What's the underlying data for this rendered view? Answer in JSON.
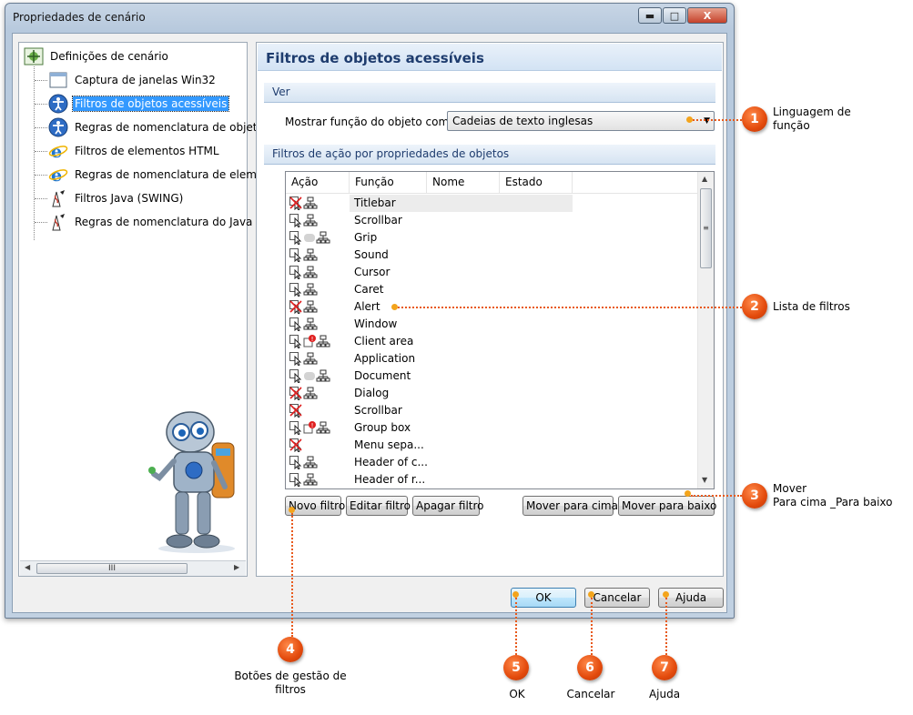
{
  "window": {
    "title": "Propriedades de cenário",
    "controls": {
      "minimize": "▬",
      "maximize": "□",
      "close": "X"
    }
  },
  "tree": {
    "root": "Definições de cenário",
    "items": [
      {
        "label": "Captura de janelas Win32",
        "icon": "window-icon"
      },
      {
        "label": "Filtros de objetos acessíveis",
        "icon": "accessibility-icon",
        "selected": true
      },
      {
        "label": "Regras de nomenclatura de objetos",
        "icon": "accessibility-icon"
      },
      {
        "label": "Filtros de elementos HTML",
        "icon": "ie-icon"
      },
      {
        "label": "Regras de nomenclatura de elemen",
        "icon": "ie-icon"
      },
      {
        "label": "Filtros Java (SWING)",
        "icon": "java-icon"
      },
      {
        "label": "Regras de nomenclatura do Java (SV",
        "icon": "java-icon"
      }
    ],
    "scroll_grip": "III"
  },
  "panel": {
    "title": "Filtros de objetos acessíveis",
    "section_view": "Ver",
    "show_label": "Mostrar função do objeto como",
    "show_value": "Cadeias de texto inglesas",
    "section_filters": "Filtros de ação por propriedades de objetos"
  },
  "list": {
    "columns": [
      "Ação",
      "Função",
      "Nome",
      "Estado"
    ],
    "rows": [
      {
        "function": "Titlebar",
        "icons": "x-tree"
      },
      {
        "function": "Scrollbar",
        "icons": "cursor-tree"
      },
      {
        "function": "Grip",
        "icons": "cursor-blur-tree"
      },
      {
        "function": "Sound",
        "icons": "cursor-tree"
      },
      {
        "function": "Cursor",
        "icons": "cursor-tree"
      },
      {
        "function": "Caret",
        "icons": "cursor-tree"
      },
      {
        "function": "Alert",
        "icons": "x-tree"
      },
      {
        "function": "Window",
        "icons": "cursor-tree"
      },
      {
        "function": "Client area",
        "icons": "cursor-alert-tree"
      },
      {
        "function": "Application",
        "icons": "cursor-tree"
      },
      {
        "function": "Document",
        "icons": "cursor-blur-tree"
      },
      {
        "function": "Dialog",
        "icons": "x-tree"
      },
      {
        "function": "Scrollbar",
        "icons": "x"
      },
      {
        "function": "Group box",
        "icons": "cursor-alert-tree"
      },
      {
        "function": "Menu sepa...",
        "icons": "x"
      },
      {
        "function": "Header of c...",
        "icons": "cursor-tree"
      },
      {
        "function": "Header of r...",
        "icons": "cursor-tree"
      }
    ],
    "scroll_grip": "≡"
  },
  "buttons": {
    "new_filter": "Novo filtro",
    "edit_filter": "Editar filtro",
    "delete_filter": "Apagar filtro",
    "move_up": "Mover para cima",
    "move_down": "Mover para baixo",
    "ok": "OK",
    "cancel": "Cancelar",
    "help": "Ajuda"
  },
  "callouts": [
    {
      "num": "1",
      "text": "Linguagem de função"
    },
    {
      "num": "2",
      "text": "Lista de filtros"
    },
    {
      "num": "3",
      "text": "Mover\nPara cima _Para baixo"
    },
    {
      "num": "4",
      "text": "Botões de gestão de filtros"
    },
    {
      "num": "5",
      "text": "OK"
    },
    {
      "num": "6",
      "text": "Cancelar"
    },
    {
      "num": "7",
      "text": "Ajuda"
    }
  ],
  "colors": {
    "accent": "#3399ff",
    "badge": "#e34a0c",
    "callout_line": "#e8591a",
    "header_text": "#1e3c6e"
  }
}
